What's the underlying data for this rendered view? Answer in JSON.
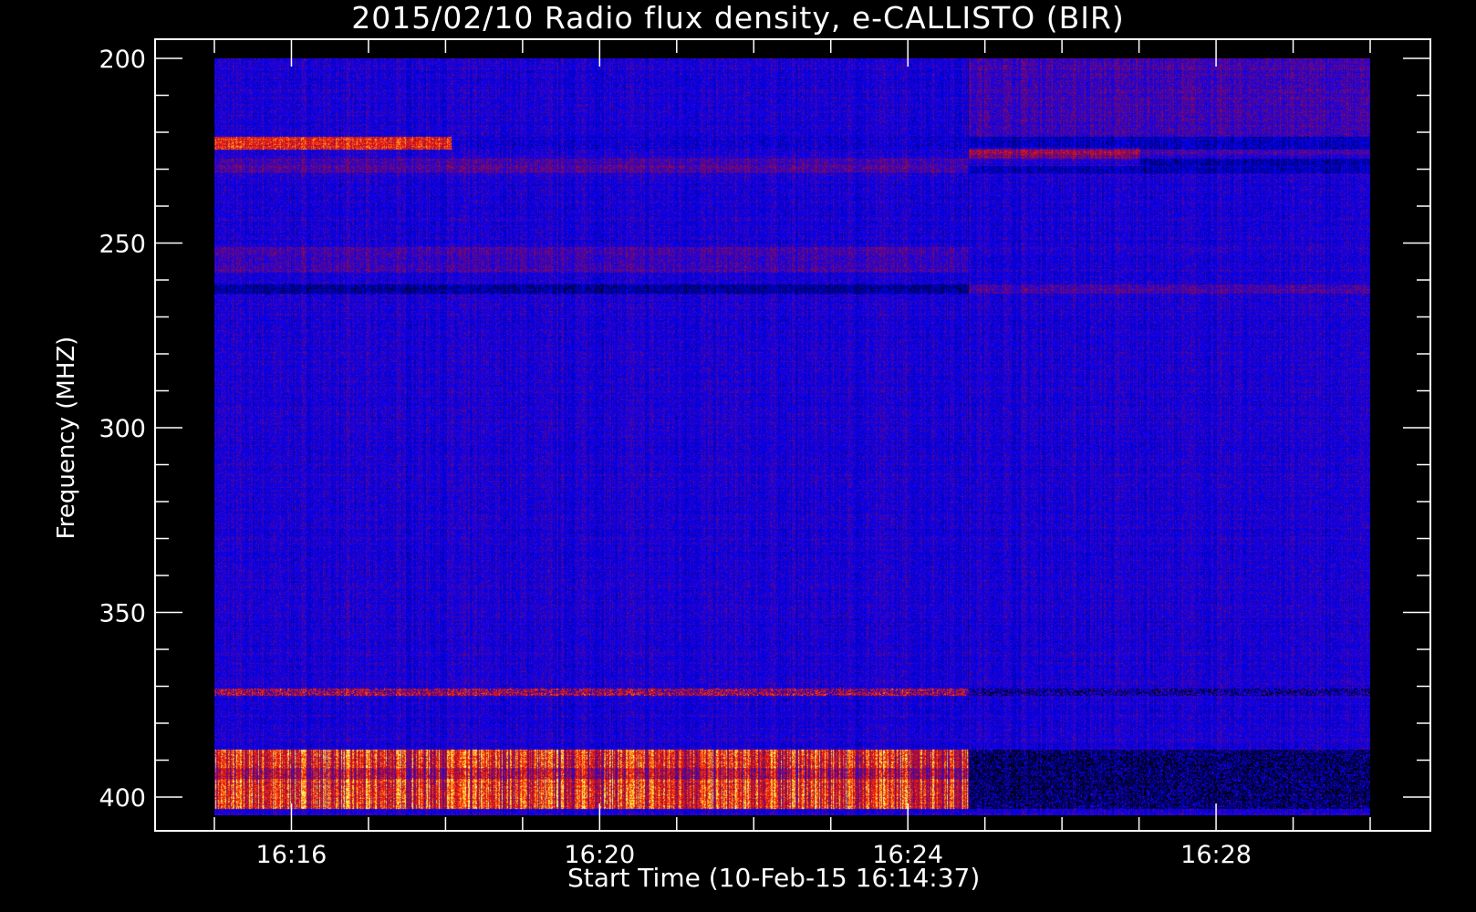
{
  "chart_data": {
    "type": "heatmap",
    "title": "2015/02/10  Radio flux density, e-CALLISTO (BIR)",
    "xlabel": "Start Time (10-Feb-15 16:14:37)",
    "ylabel": "Frequency (MHZ)",
    "x_range": [
      "16:15",
      "16:30"
    ],
    "y_range": [
      200,
      405
    ],
    "y_inverted": true,
    "x_ticks": [
      "16:16",
      "16:20",
      "16:24",
      "16:28"
    ],
    "y_ticks": [
      200,
      250,
      300,
      350,
      400
    ],
    "grid": false,
    "colormap": [
      "#000000",
      "#0000ff",
      "#8b0a50",
      "#ff2000",
      "#ffff40",
      "#ffffff"
    ]
  }
}
